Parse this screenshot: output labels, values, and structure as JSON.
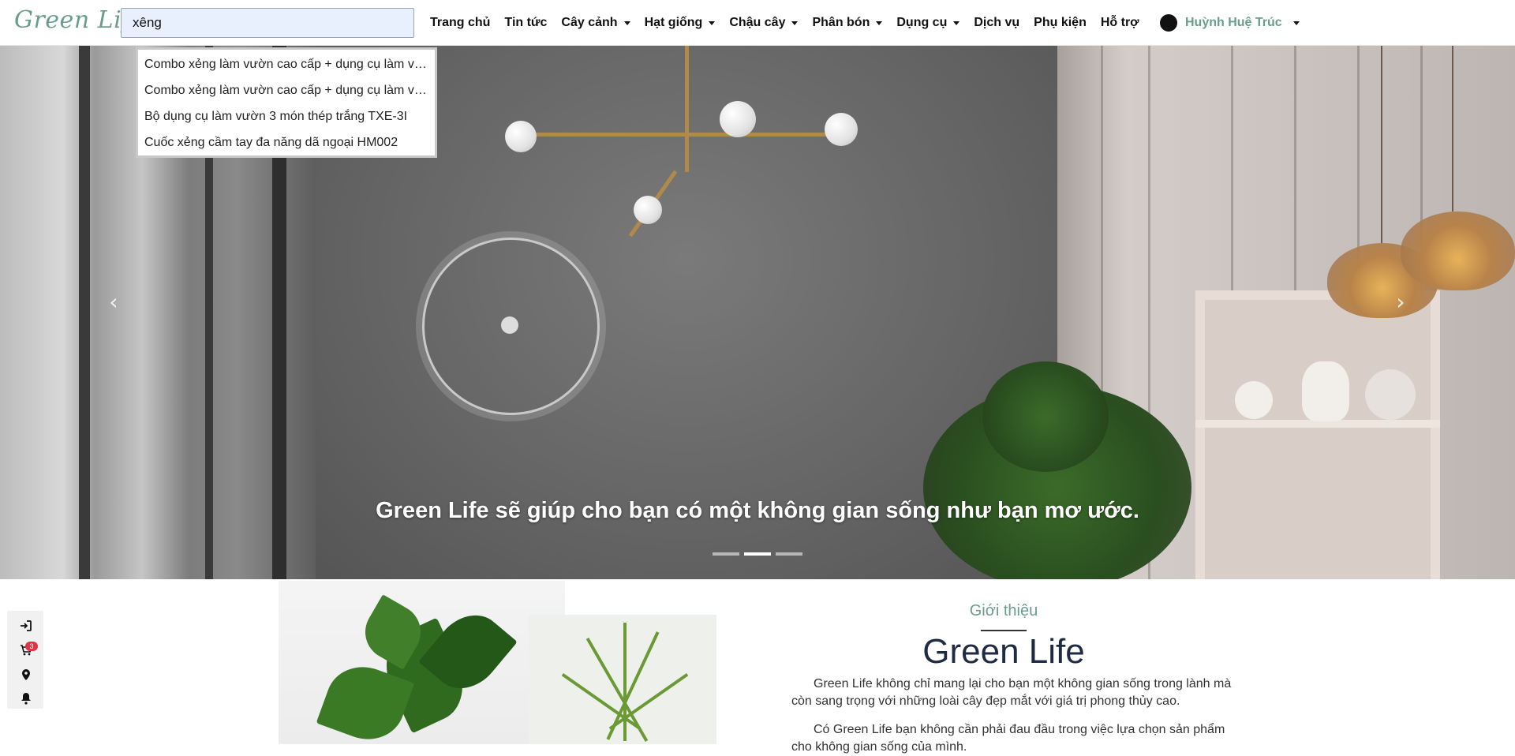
{
  "brand": "Green Life",
  "search": {
    "value": "xêng",
    "suggestions": [
      "Combo xẻng làm vườn cao cấp + dụng cụ làm vườn",
      "Combo xẻng làm vườn cao cấp + dụng cụ làm vườn",
      "Bộ dụng cụ làm vườn 3 món thép trắng TXE-3I",
      "Cuốc xẻng cầm tay đa năng dã ngoại HM002"
    ]
  },
  "nav": {
    "home": "Trang chủ",
    "news": "Tin tức",
    "plants": "Cây cảnh",
    "seeds": "Hạt giống",
    "pots": "Chậu cây",
    "fertilizer": "Phân bón",
    "tools": "Dụng cụ",
    "services": "Dịch vụ",
    "accessories": "Phụ kiện",
    "support": "Hỗ trợ"
  },
  "user": {
    "name": "Huỳnh Huệ Trúc"
  },
  "hero": {
    "caption": "Green Life sẽ giúp cho bạn có một không gian sống như bạn mơ ước.",
    "slides": 3,
    "active_slide": 2
  },
  "intro": {
    "eyebrow": "Giới thiệu",
    "title": "Green Life",
    "p1": "Green Life không chỉ mang lại cho bạn một không gian sống trong lành mà còn sang trọng với những loài cây đẹp mắt với giá trị phong thủy cao.",
    "p2": "Có Green Life bạn không cần phải đau đầu trong việc lựa chọn sản phẩm cho không gian sống của mình."
  },
  "side_widget": {
    "cart_count": "3"
  },
  "colors": {
    "brand_green": "#6a9e8c",
    "title_navy": "#1f2a44",
    "badge_red": "#dc3545"
  }
}
